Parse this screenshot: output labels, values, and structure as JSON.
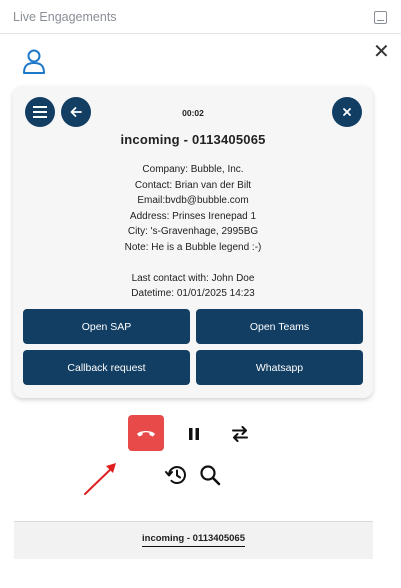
{
  "window": {
    "title": "Live Engagements"
  },
  "call": {
    "timer": "00:02",
    "caller_title": "incoming - 0113405065",
    "details": [
      "Company: Bubble, Inc.",
      "Contact: Brian van der Bilt",
      "Email:bvdb@bubble.com",
      "Address: Prinses Irenepad 1",
      "City: 's-Gravenhage, 2995BG",
      "Note: He is a Bubble legend :-)"
    ],
    "last_contact": "Last contact with: John Doe",
    "datetime": "Datetime: 01/01/2025 14:23"
  },
  "actions": {
    "open_sap": "Open SAP",
    "open_teams": "Open Teams",
    "callback": "Callback request",
    "whatsapp": "Whatsapp"
  },
  "bottom_tab": {
    "label": "incoming - 0113405065"
  },
  "icons": {
    "menu": "menu-icon",
    "back": "arrow-left-icon",
    "close": "close-icon",
    "user": "user-icon",
    "hangup": "phone-hangup-icon",
    "pause": "pause-icon",
    "transfer": "transfer-icon",
    "history": "history-icon",
    "search": "search-icon"
  },
  "colors": {
    "primary": "#123e63",
    "hangup": "#e84a4a",
    "annotation_arrow": "#e02020",
    "user_icon": "#1f78c8"
  }
}
